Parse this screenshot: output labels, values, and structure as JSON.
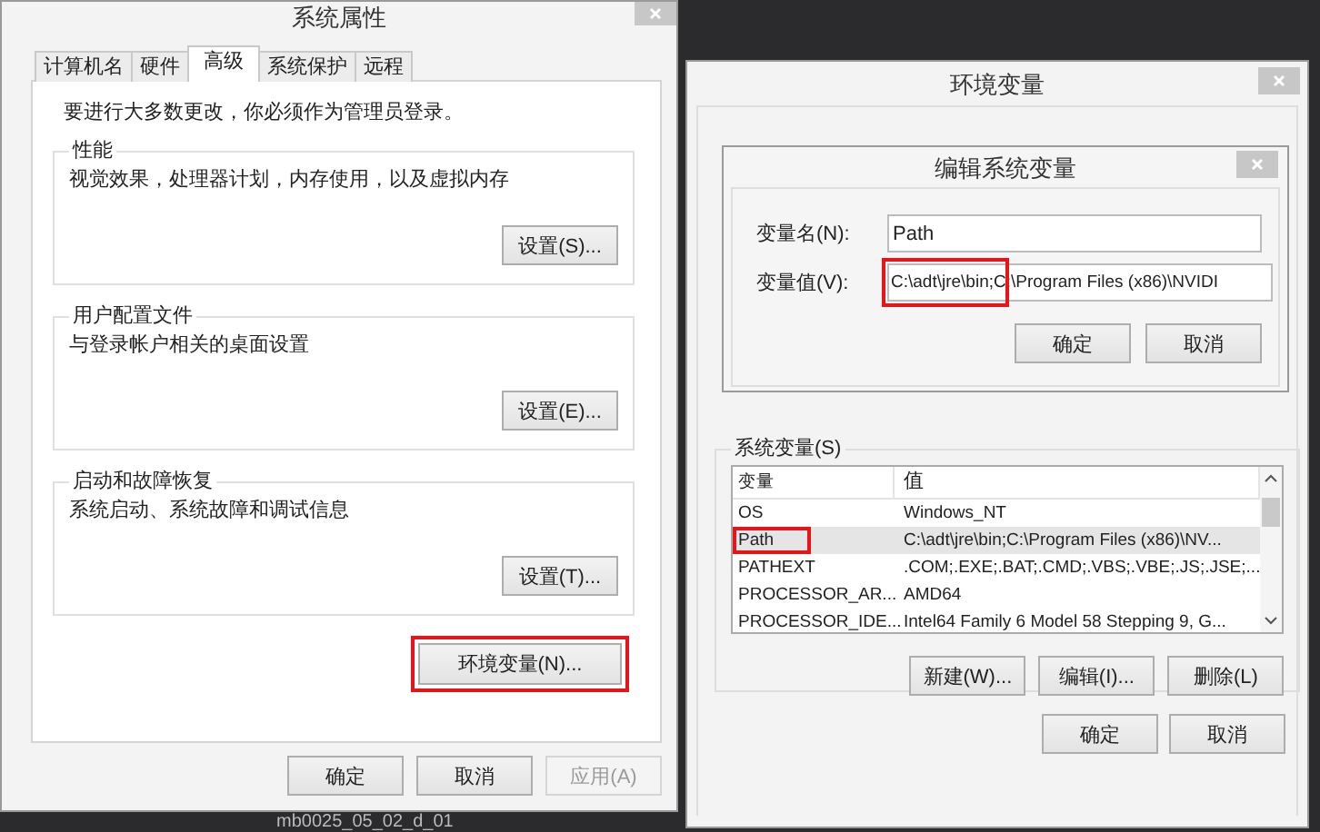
{
  "system_properties": {
    "title": "系统属性",
    "tabs": [
      {
        "label": "计算机名",
        "selected": false
      },
      {
        "label": "硬件",
        "selected": false
      },
      {
        "label": "高级",
        "selected": true
      },
      {
        "label": "系统保护",
        "selected": false
      },
      {
        "label": "远程",
        "selected": false
      }
    ],
    "notice": "要进行大多数更改，你必须作为管理员登录。",
    "groups": [
      {
        "title": "性能",
        "description": "视觉效果，处理器计划，内存使用，以及虚拟内存",
        "button": "设置(S)..."
      },
      {
        "title": "用户配置文件",
        "description": "与登录帐户相关的桌面设置",
        "button": "设置(E)..."
      },
      {
        "title": "启动和故障恢复",
        "description": "系统启动、系统故障和调试信息",
        "button": "设置(T)..."
      }
    ],
    "env_button": {
      "label": "环境变量(N)...",
      "highlighted": true
    },
    "buttons": [
      {
        "label": "确定",
        "disabled": false
      },
      {
        "label": "取消",
        "disabled": false
      },
      {
        "label": "应用(A)",
        "disabled": true
      }
    ]
  },
  "environment_variables": {
    "title": "环境变量",
    "system_variables": {
      "title": "系统变量(S)",
      "columns": [
        "变量",
        "值"
      ],
      "rows": [
        {
          "name": "OS",
          "value": "Windows_NT",
          "selected": false,
          "highlighted": false
        },
        {
          "name": "Path",
          "value": "C:\\adt\\jre\\bin;C:\\Program Files (x86)\\NV...",
          "selected": true,
          "highlighted": true
        },
        {
          "name": "PATHEXT",
          "value": ".COM;.EXE;.BAT;.CMD;.VBS;.VBE;.JS;.JSE;...",
          "selected": false,
          "highlighted": false
        },
        {
          "name": "PROCESSOR_AR...",
          "value": "AMD64",
          "selected": false,
          "highlighted": false
        },
        {
          "name": "PROCESSOR_IDE...",
          "value": "Intel64 Family 6 Model 58 Stepping 9, G...",
          "selected": false,
          "highlighted": false
        }
      ]
    },
    "list_buttons": [
      "新建(W)...",
      "编辑(I)...",
      "删除(L)"
    ],
    "buttons": [
      "确定",
      "取消"
    ]
  },
  "edit_dialog": {
    "title": "编辑系统变量",
    "name_label": "变量名(N):",
    "name_value": "Path",
    "value_label": "变量值(V):",
    "value_value": "C:\\adt\\jre\\bin;C:\\Program Files (x86)\\NVIDI",
    "value_highlighted": true,
    "buttons": [
      "确定",
      "取消"
    ]
  },
  "desktop": {
    "file_label": "mb0025_05_02_d_01"
  }
}
